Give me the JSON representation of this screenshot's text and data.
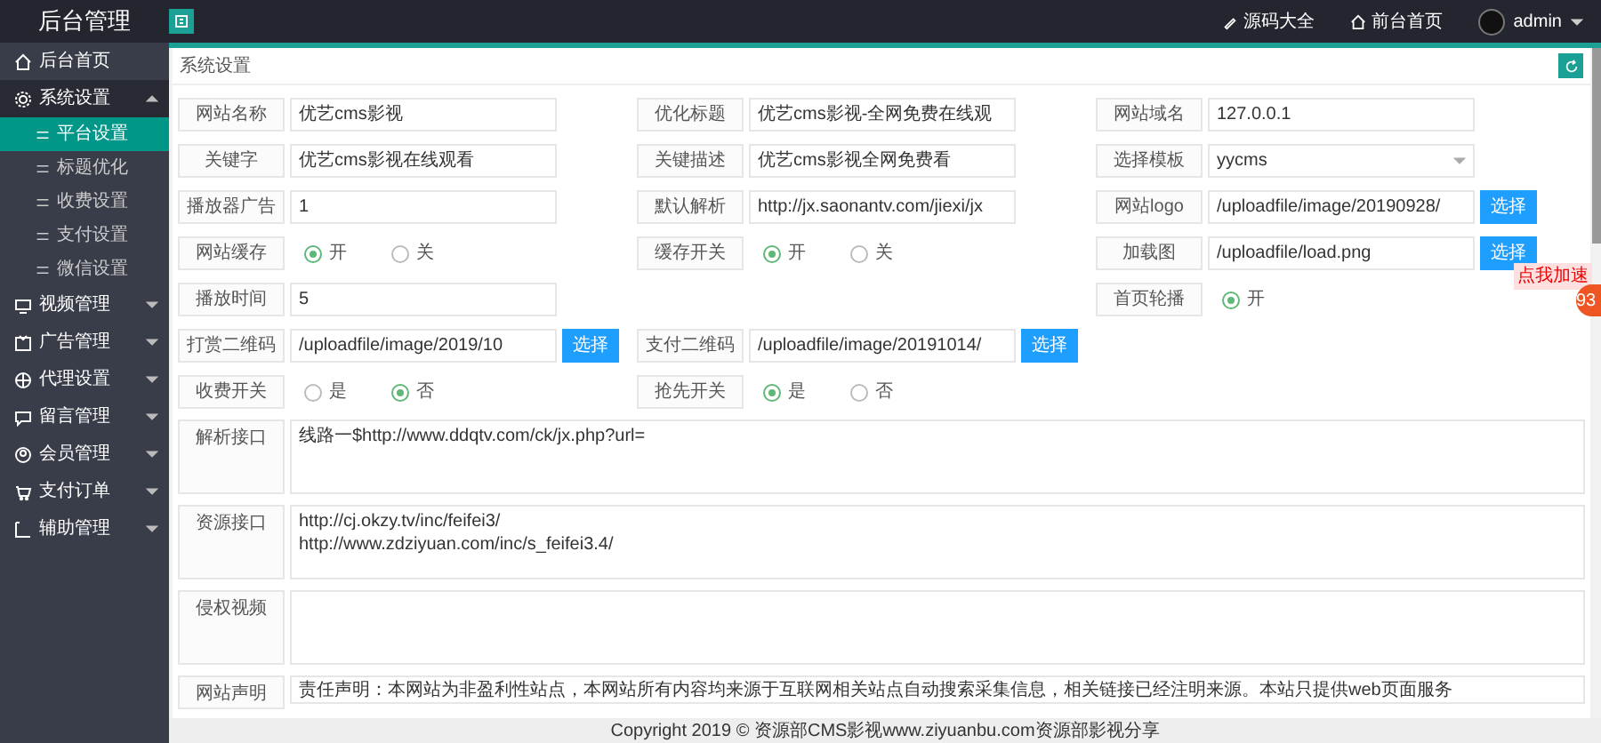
{
  "topbar": {
    "brand": "后台管理",
    "links": [
      {
        "label": "源码大全"
      },
      {
        "label": "前台首页"
      }
    ],
    "user": "admin"
  },
  "sidebar": [
    {
      "label": "后台首页",
      "kind": "link",
      "selected": false
    },
    {
      "label": "系统设置",
      "kind": "group",
      "expanded": true,
      "selected": true,
      "children": [
        {
          "label": "平台设置",
          "selected": true
        },
        {
          "label": "标题优化",
          "selected": false
        },
        {
          "label": "收费设置",
          "selected": false
        },
        {
          "label": "支付设置",
          "selected": false
        },
        {
          "label": "微信设置",
          "selected": false
        }
      ]
    },
    {
      "label": "视频管理",
      "kind": "group",
      "expanded": false,
      "selected": false
    },
    {
      "label": "广告管理",
      "kind": "group",
      "expanded": false,
      "selected": false
    },
    {
      "label": "代理设置",
      "kind": "group",
      "expanded": false,
      "selected": false
    },
    {
      "label": "留言管理",
      "kind": "group",
      "expanded": false,
      "selected": false
    },
    {
      "label": "会员管理",
      "kind": "group",
      "expanded": false,
      "selected": false
    },
    {
      "label": "支付订单",
      "kind": "group",
      "expanded": false,
      "selected": false
    },
    {
      "label": "辅助管理",
      "kind": "group",
      "expanded": false,
      "selected": false
    }
  ],
  "panel": {
    "title": "系统设置",
    "rows": [
      [
        {
          "kind": "text",
          "label": "网站名称",
          "value": "优艺cms影视"
        },
        {
          "kind": "text",
          "label": "优化标题",
          "value": "优艺cms影视-全网免费在线观"
        },
        {
          "kind": "text",
          "label": "网站域名",
          "value": "127.0.0.1"
        }
      ],
      [
        {
          "kind": "text",
          "label": "关键字",
          "value": "优艺cms影视在线观看"
        },
        {
          "kind": "text",
          "label": "关键描述",
          "value": "优艺cms影视全网免费看"
        },
        {
          "kind": "select",
          "label": "选择模板",
          "value": "yycms"
        }
      ],
      [
        {
          "kind": "text",
          "label": "播放器广告",
          "value": "1"
        },
        {
          "kind": "text",
          "label": "默认解析",
          "value": "http://jx.saonantv.com/jiexi/jx"
        },
        {
          "kind": "upload",
          "label": "网站logo",
          "value": "/uploadfile/image/20190928/",
          "button": "选择"
        }
      ],
      [
        {
          "kind": "radio",
          "label": "网站缓存",
          "options": [
            {
              "label": "开",
              "selected": true
            },
            {
              "label": "关",
              "selected": false
            }
          ]
        },
        {
          "kind": "radio",
          "label": "缓存开关",
          "options": [
            {
              "label": "开",
              "selected": true
            },
            {
              "label": "关",
              "selected": false
            }
          ]
        },
        {
          "kind": "upload",
          "label": "加载图",
          "value": "/uploadfile/load.png",
          "button": "选择"
        }
      ],
      [
        {
          "kind": "text",
          "label": "播放时间",
          "value": "5"
        },
        {
          "kind": "blank"
        },
        {
          "kind": "radio",
          "label": "首页轮播",
          "options": [
            {
              "label": "开",
              "selected": true
            }
          ]
        }
      ],
      [
        {
          "kind": "upload",
          "label": "打赏二维码",
          "value": "/uploadfile/image/2019/10",
          "button": "选择"
        },
        {
          "kind": "upload",
          "label": "支付二维码",
          "value": "/uploadfile/image/20191014/",
          "button": "选择"
        },
        {
          "kind": "blank"
        }
      ],
      [
        {
          "kind": "radio",
          "label": "收费开关",
          "options": [
            {
              "label": "是",
              "selected": false
            },
            {
              "label": "否",
              "selected": true
            }
          ]
        },
        {
          "kind": "radio",
          "label": "抢先开关",
          "options": [
            {
              "label": "是",
              "selected": true
            },
            {
              "label": "否",
              "selected": false
            }
          ]
        },
        {
          "kind": "blank"
        }
      ]
    ],
    "areas": [
      {
        "label": "解析接口",
        "lines": [
          "线路一$http://www.ddqtv.com/ck/jx.php?url="
        ]
      },
      {
        "label": "资源接口",
        "lines": [
          "http://cj.okzy.tv/inc/feifei3/",
          "http://www.zdziyuan.com/inc/s_feifei3.4/"
        ]
      },
      {
        "label": "侵权视频"
      },
      {
        "label": "网站声明",
        "lines": [
          "责任声明：本网站为非盈利性站点，本网站所有内容均来源于互联网相关站点自动搜索采集信息，相关链接已经注明来源。本站只提供web页面服务"
        ]
      }
    ]
  },
  "footer": "Copyright 2019 © 资源部CMS影视www.ziyuanbu.com资源部影视分享",
  "float_widget": {
    "tag": "点我加速",
    "count": "93"
  }
}
